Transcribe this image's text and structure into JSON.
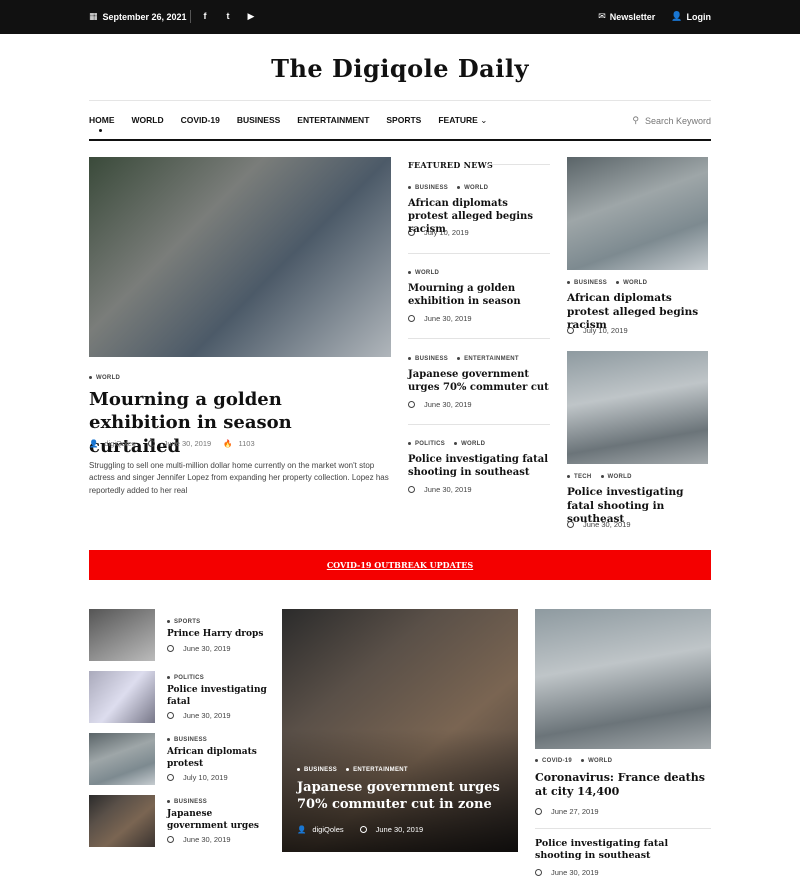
{
  "topbar": {
    "date": "September 26, 2021",
    "newsletter": "Newsletter",
    "login": "Login"
  },
  "site": {
    "title": "The Digiqole Daily"
  },
  "nav": {
    "items": [
      "HOME",
      "WORLD",
      "COVID-19",
      "BUSINESS",
      "ENTERTAINMENT",
      "SPORTS",
      "FEATURE"
    ],
    "search_placeholder": "Search Keyword"
  },
  "hero": {
    "category": "WORLD",
    "title": "Mourning a golden exhibition in season curtailed",
    "author": "digiQoles",
    "date": "June 30, 2019",
    "views": "1103",
    "excerpt": "Struggling to sell one multi-million dollar home currently on the market won't stop actress and singer Jennifer Lopez from expanding her property collection. Lopez has reportedly added to her real"
  },
  "featured": {
    "heading": "FEATURED NEWS",
    "items": [
      {
        "cats": [
          "BUSINESS",
          "WORLD"
        ],
        "title": "African diplomats protest alleged begins racism",
        "date": "July 10, 2019"
      },
      {
        "cats": [
          "WORLD"
        ],
        "title": "Mourning a golden exhibition in season",
        "date": "June 30, 2019"
      },
      {
        "cats": [
          "BUSINESS",
          "ENTERTAINMENT"
        ],
        "title": "Japanese government urges 70% commuter cut",
        "date": "June 30, 2019"
      },
      {
        "cats": [
          "POLITICS",
          "WORLD"
        ],
        "title": "Police investigating fatal shooting in southeast",
        "date": "June 30, 2019"
      }
    ]
  },
  "side": [
    {
      "cats": [
        "BUSINESS",
        "WORLD"
      ],
      "title": "African diplomats protest alleged begins racism",
      "date": "July 10, 2019"
    },
    {
      "cats": [
        "TECH",
        "WORLD"
      ],
      "title": "Police investigating fatal shooting in southeast",
      "date": "June 30, 2019"
    }
  ],
  "banner": {
    "text": "COVID-19 OUTBREAK UPDATES"
  },
  "small": [
    {
      "cat": "SPORTS",
      "title": "Prince Harry drops",
      "date": "June 30, 2019"
    },
    {
      "cat": "POLITICS",
      "title": "Police investigating fatal",
      "date": "June 30, 2019"
    },
    {
      "cat": "BUSINESS",
      "title": "African diplomats protest",
      "date": "July 10, 2019"
    },
    {
      "cat": "BUSINESS",
      "title": "Japanese government urges",
      "date": "June 30, 2019"
    }
  ],
  "center": {
    "cats": [
      "BUSINESS",
      "ENTERTAINMENT"
    ],
    "title": "Japanese government urges 70% commuter cut in zone",
    "author": "digiQoles",
    "date": "June 30, 2019"
  },
  "right": {
    "cats": [
      "COVID-19",
      "WORLD"
    ],
    "title": "Coronavirus: France deaths at city 14,400",
    "date": "June 27, 2019",
    "title2": "Police investigating fatal shooting in southeast",
    "date2": "June 30, 2019"
  }
}
